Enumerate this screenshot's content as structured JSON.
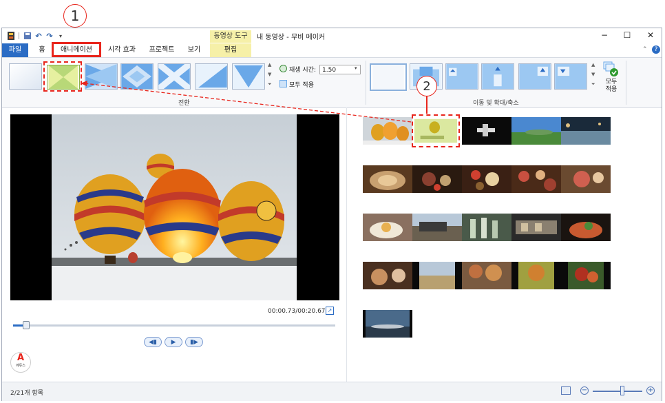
{
  "quick_access": {
    "icons": [
      "film-icon",
      "save-icon",
      "undo-icon",
      "redo-icon",
      "dropdown-icon"
    ]
  },
  "window": {
    "contextual_header": "동영상 도구",
    "title": "내 동영상 - 무비 메이커",
    "controls": {
      "minimize": "−",
      "maximize": "☐",
      "close": "✕"
    }
  },
  "tabs": {
    "file": "파일",
    "home": "홈",
    "animation": "애니메이션",
    "visual_effects": "시각 효과",
    "project": "프로젝트",
    "view": "보기",
    "edit": "편집"
  },
  "ribbon": {
    "transitions": {
      "label": "전환",
      "duration_label": "재생 시간:",
      "duration_value": "1.50",
      "apply_all": "모두 적용"
    },
    "pan_zoom": {
      "label": "이동 및 확대/축소",
      "apply_all": "모두\n적용"
    }
  },
  "preview": {
    "time": "00:00.73/00:20.67",
    "progress": 0.035
  },
  "status": {
    "item_count": "2/21개 항목",
    "zoom_level": 0.6
  },
  "annotations": {
    "callout1": "1",
    "callout2": "2"
  },
  "logo_text": "에듀스"
}
